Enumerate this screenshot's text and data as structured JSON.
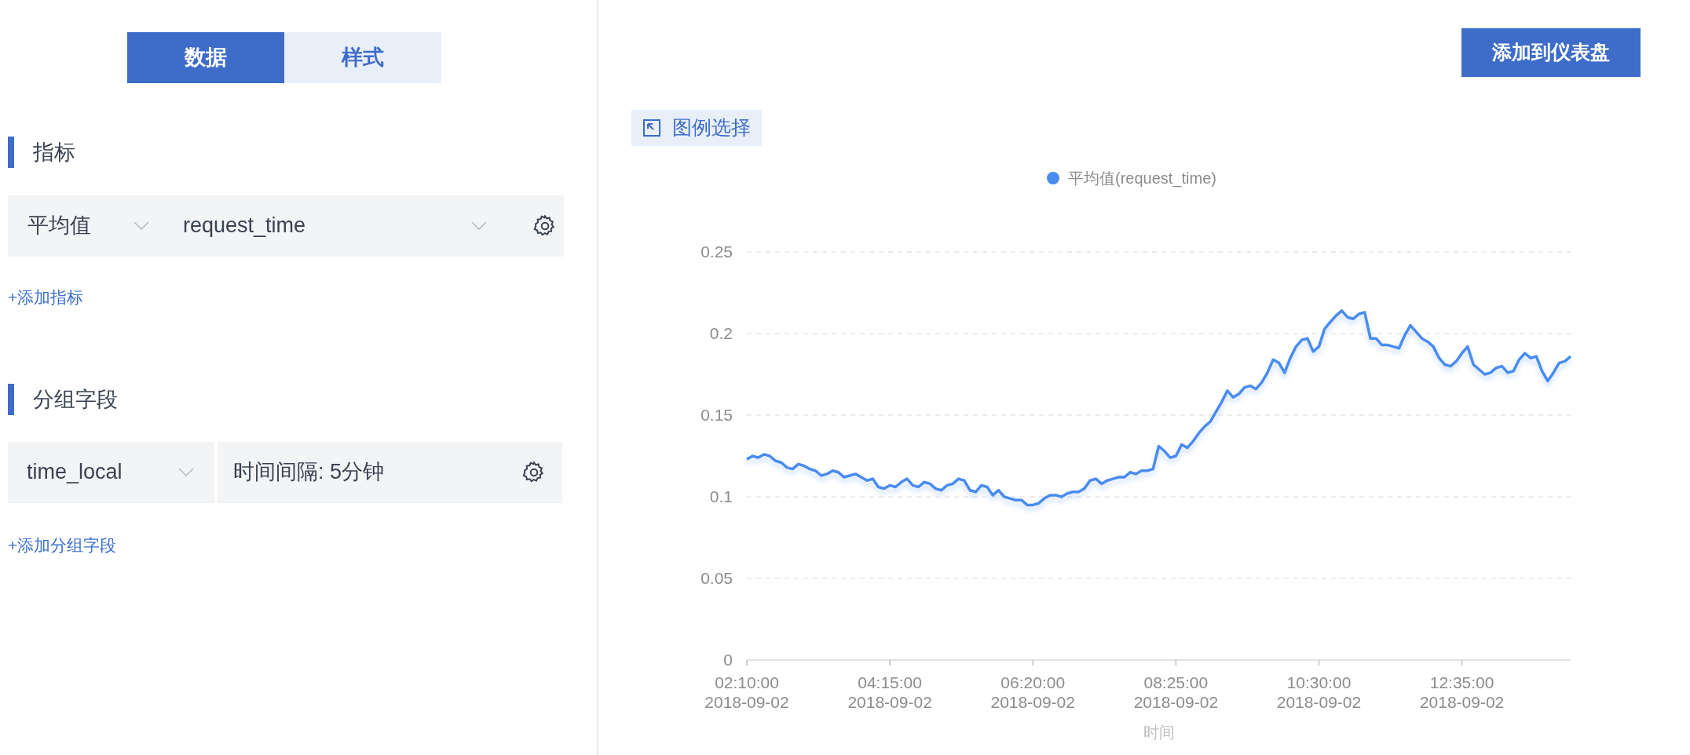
{
  "tabs": [
    {
      "label": "数据",
      "selected": true
    },
    {
      "label": "样式",
      "selected": false
    }
  ],
  "metrics": {
    "title": "指标",
    "rows": [
      {
        "aggregation": "平均值",
        "field": "request_time"
      }
    ],
    "add_link": "+添加指标"
  },
  "group_by": {
    "title": "分组字段",
    "rows": [
      {
        "field": "time_local",
        "interval": "时间间隔: 5分钟"
      }
    ],
    "add_link": "+添加分组字段"
  },
  "add_to_dashboard_button": "添加到仪表盘",
  "legend_select_button": "图例选择",
  "chart_data": {
    "type": "line",
    "xlabel": "时间",
    "categories": [
      "02:10:00\n2018-09-02",
      null,
      null,
      null,
      null,
      null,
      null,
      null,
      null,
      null,
      null,
      null,
      null,
      null,
      null,
      null,
      null,
      null,
      null,
      null,
      null,
      null,
      null,
      null,
      null,
      "04:15:00\n2018-09-02",
      null,
      null,
      null,
      null,
      null,
      null,
      null,
      null,
      null,
      null,
      null,
      null,
      null,
      null,
      null,
      null,
      null,
      null,
      null,
      null,
      null,
      null,
      null,
      null,
      "06:20:00\n2018-09-02",
      null,
      null,
      null,
      null,
      null,
      null,
      null,
      null,
      null,
      null,
      null,
      null,
      null,
      null,
      null,
      null,
      null,
      null,
      null,
      null,
      null,
      null,
      null,
      null,
      "08:25:00\n2018-09-02",
      null,
      null,
      null,
      null,
      null,
      null,
      null,
      null,
      null,
      null,
      null,
      null,
      null,
      null,
      null,
      null,
      null,
      null,
      null,
      null,
      null,
      null,
      null,
      null,
      "10:30:00\n2018-09-02",
      null,
      null,
      null,
      null,
      null,
      null,
      null,
      null,
      null,
      null,
      null,
      null,
      null,
      null,
      null,
      null,
      null,
      null,
      null,
      null,
      null,
      null,
      null,
      null,
      "12:35:00\n2018-09-02",
      null,
      null,
      null,
      null,
      null,
      null,
      null,
      null,
      null,
      null,
      null,
      null,
      null,
      null,
      null,
      null,
      null,
      null,
      null
    ],
    "series": [
      {
        "name": "平均值(request_time)",
        "color": "#4a8cf0",
        "values": [
          0.123,
          0.125,
          0.124,
          0.126,
          0.125,
          0.122,
          0.121,
          0.118,
          0.117,
          0.12,
          0.119,
          0.117,
          0.116,
          0.113,
          0.114,
          0.116,
          0.115,
          0.112,
          0.113,
          0.114,
          0.112,
          0.11,
          0.111,
          0.106,
          0.105,
          0.107,
          0.106,
          0.109,
          0.111,
          0.107,
          0.106,
          0.109,
          0.108,
          0.105,
          0.104,
          0.107,
          0.108,
          0.111,
          0.11,
          0.104,
          0.103,
          0.107,
          0.106,
          0.101,
          0.104,
          0.1,
          0.099,
          0.098,
          0.098,
          0.095,
          0.095,
          0.096,
          0.099,
          0.101,
          0.101,
          0.1,
          0.102,
          0.103,
          0.103,
          0.105,
          0.11,
          0.111,
          0.108,
          0.11,
          0.111,
          0.112,
          0.112,
          0.115,
          0.114,
          0.116,
          0.116,
          0.117,
          0.131,
          0.128,
          0.124,
          0.125,
          0.132,
          0.13,
          0.134,
          0.139,
          0.143,
          0.146,
          0.152,
          0.158,
          0.165,
          0.161,
          0.163,
          0.167,
          0.168,
          0.166,
          0.17,
          0.176,
          0.184,
          0.182,
          0.176,
          0.185,
          0.192,
          0.196,
          0.197,
          0.189,
          0.192,
          0.203,
          0.207,
          0.211,
          0.214,
          0.21,
          0.209,
          0.212,
          0.213,
          0.197,
          0.197,
          0.193,
          0.193,
          0.192,
          0.191,
          0.199,
          0.205,
          0.201,
          0.197,
          0.195,
          0.192,
          0.185,
          0.181,
          0.18,
          0.183,
          0.188,
          0.192,
          0.181,
          0.178,
          0.175,
          0.176,
          0.179,
          0.18,
          0.176,
          0.177,
          0.184,
          0.188,
          0.185,
          0.186,
          0.177,
          0.171,
          0.176,
          0.182,
          0.183,
          0.186
        ]
      }
    ],
    "ylim": [
      0,
      0.25
    ],
    "grid": true,
    "yticks": [
      {
        "value": 0,
        "label": "0"
      },
      {
        "value": 0.05,
        "label": "0.05"
      },
      {
        "value": 0.1,
        "label": "0.1"
      },
      {
        "value": 0.15,
        "label": "0.15"
      },
      {
        "value": 0.2,
        "label": "0.2"
      },
      {
        "value": 0.25,
        "label": "0.25"
      }
    ]
  }
}
